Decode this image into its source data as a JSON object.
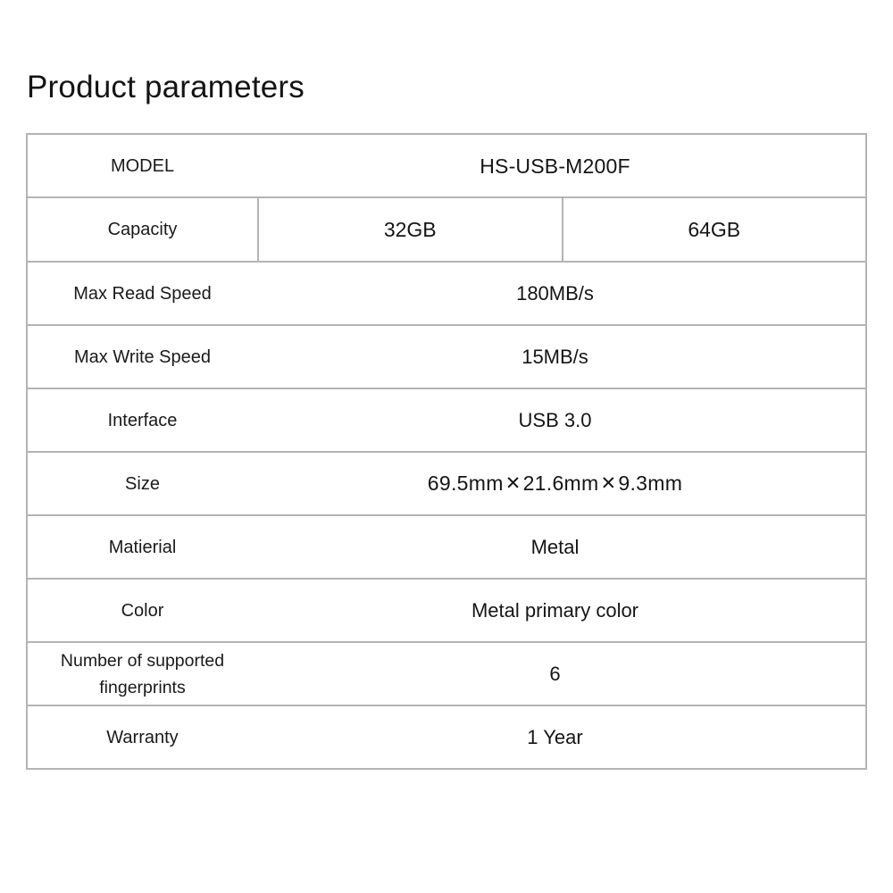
{
  "page": {
    "title": "Product parameters",
    "background_color": "#ffffff",
    "text_color": "#1a1a1a",
    "border_color": "#b4b4b4"
  },
  "table": {
    "rows": [
      {
        "label": "MODEL",
        "value": "HS-USB-M200F",
        "split": false
      },
      {
        "label": "Capacity",
        "value_left": "32GB",
        "value_right": "64GB",
        "split": true
      },
      {
        "label": "Max Read Speed",
        "value": "180MB/s",
        "split": false
      },
      {
        "label": "Max Write Speed",
        "value": "15MB/s",
        "split": false
      },
      {
        "label": "Interface",
        "value": "USB 3.0",
        "split": false
      },
      {
        "label": "Size",
        "value": "69.5mm✕21.6mm✕9.3mm",
        "value_part_1": "69.5mm",
        "value_sep_1": "✕",
        "value_part_2": "21.6mm",
        "value_sep_2": "✕",
        "value_part_3": "9.3mm",
        "split": false
      },
      {
        "label": "Matierial",
        "value": "Metal",
        "split": false
      },
      {
        "label": "Color",
        "value": "Metal primary color",
        "split": false
      },
      {
        "label": "Number of supported fingerprints",
        "label_line_1": "Number of supported",
        "label_line_2": "fingerprints",
        "value": "6",
        "split": false
      },
      {
        "label": "Warranty",
        "value": "1 Year",
        "split": false
      }
    ]
  }
}
